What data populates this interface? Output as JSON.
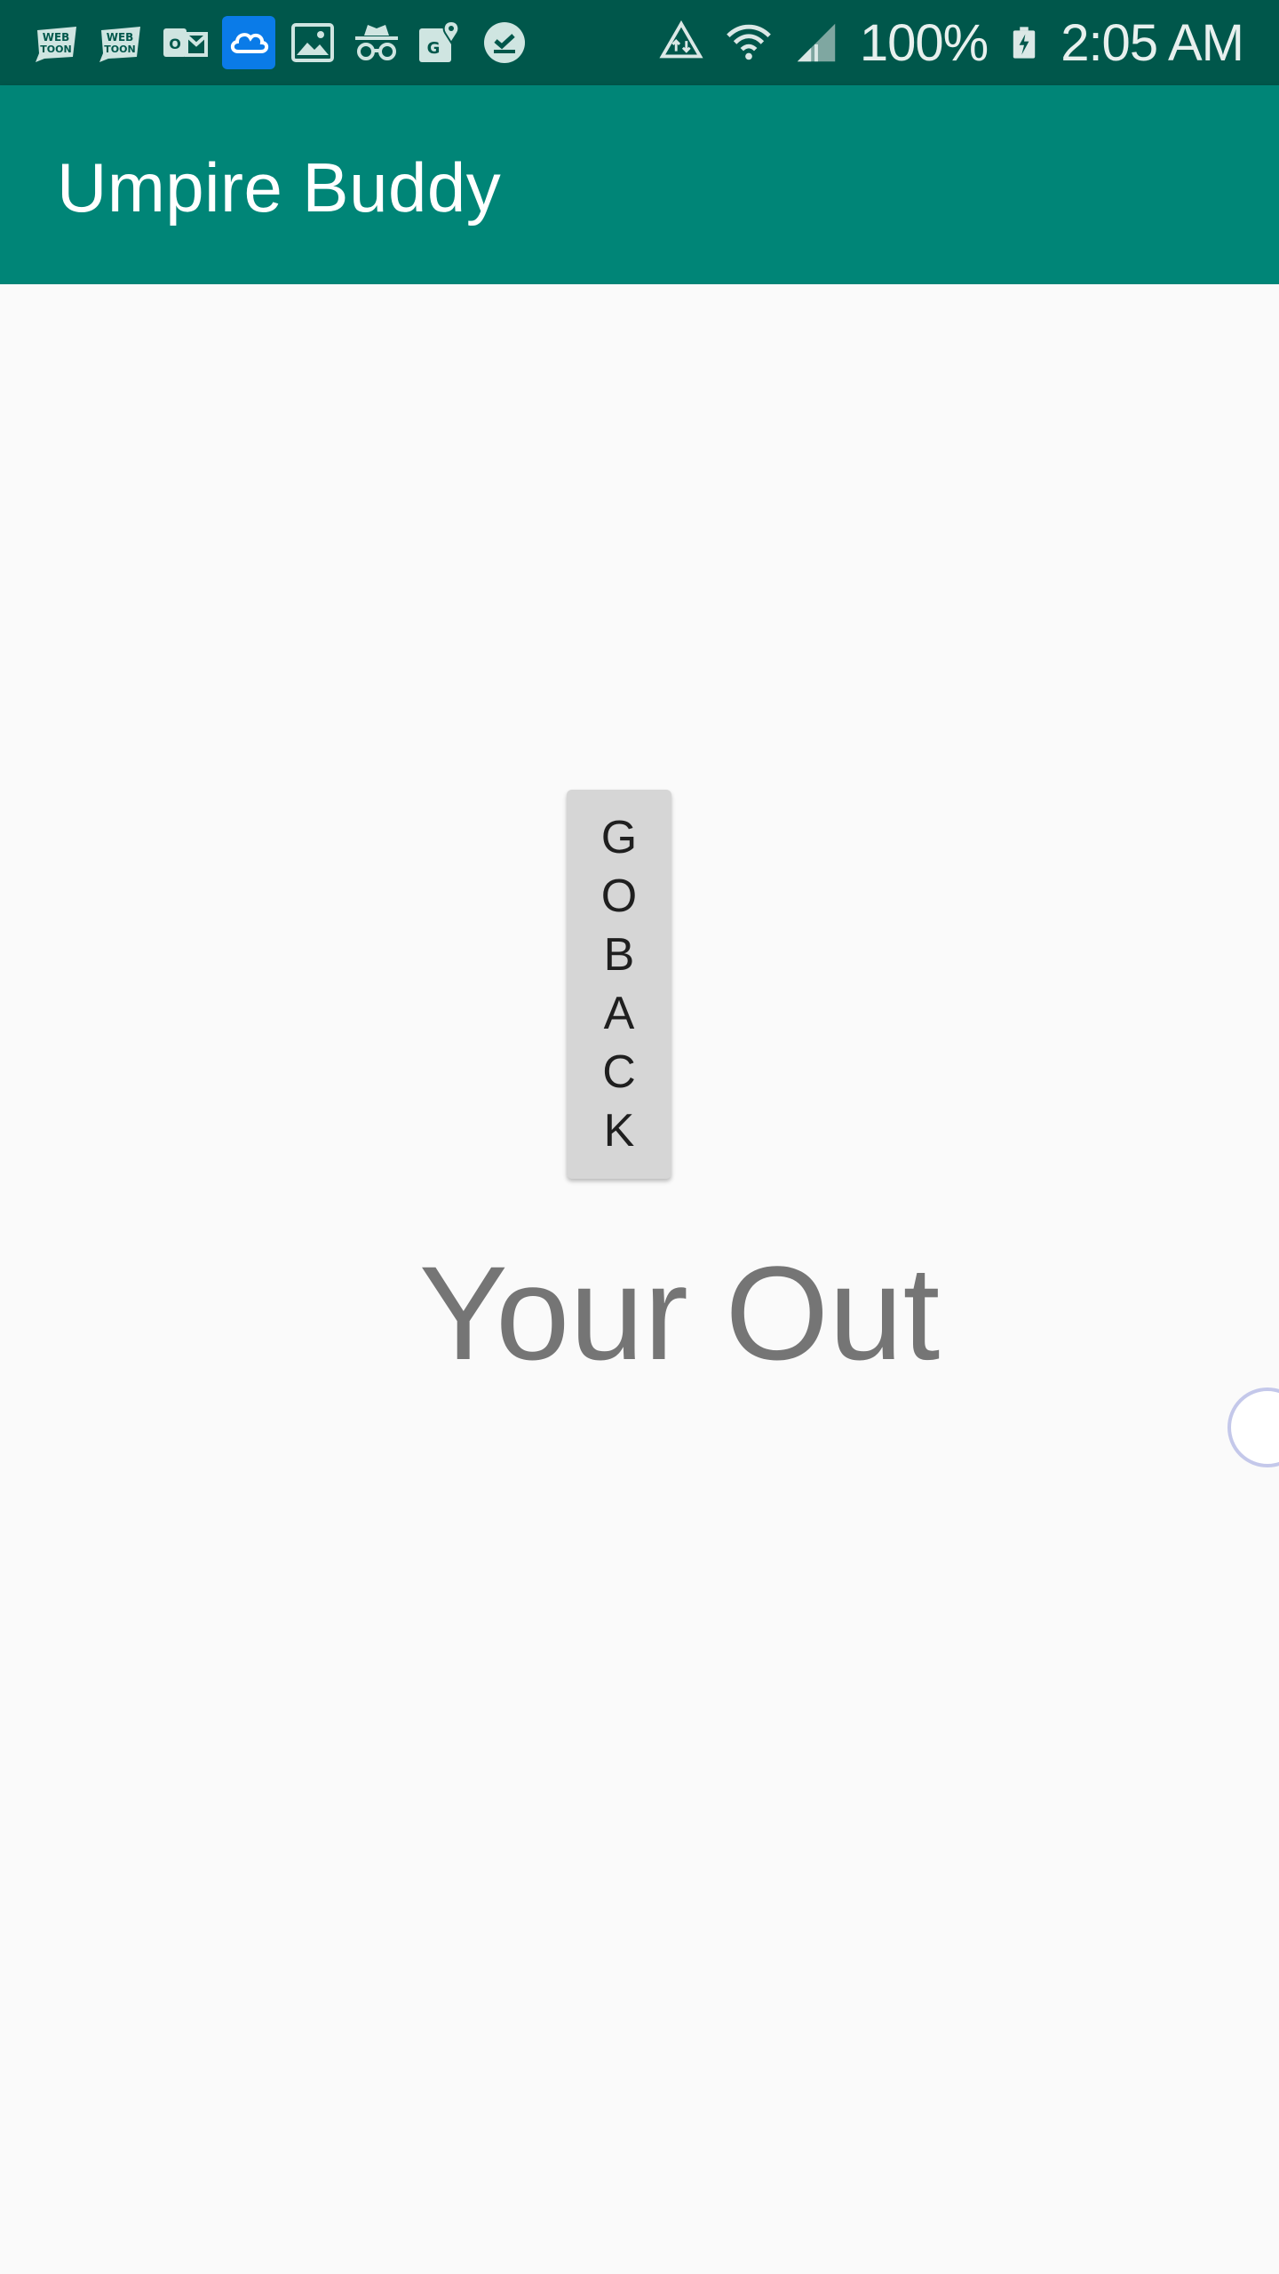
{
  "status_bar": {
    "icons_left": [
      "webtoon-icon",
      "webtoon-icon",
      "outlook-icon",
      "cloud-icon",
      "image-icon",
      "incognito-icon",
      "maps-icon",
      "check-circle-icon"
    ],
    "battery_percent": "100%",
    "time": "2:05 AM",
    "colors": {
      "background": "#00574b"
    }
  },
  "app_bar": {
    "title": "Umpire Buddy",
    "colors": {
      "background": "#008577"
    }
  },
  "main": {
    "go_back_label": "GO BACK",
    "result_text": "Your Out"
  }
}
